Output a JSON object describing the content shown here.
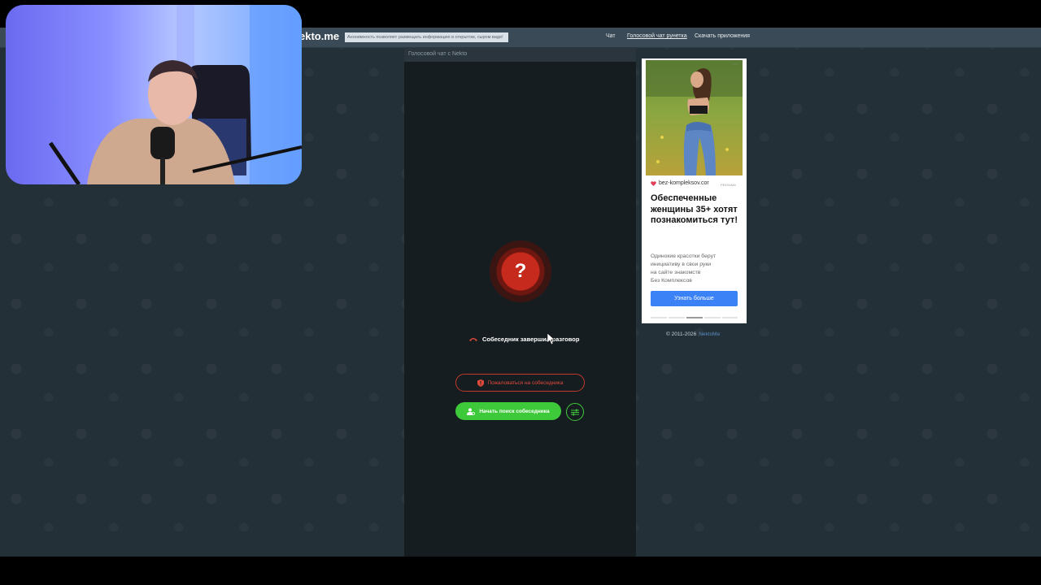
{
  "header": {
    "logo": "ekto.me",
    "banner": "Анонимность позволяет размещать информацию в открытом, сыром виде!",
    "nav": [
      {
        "label": "Чат",
        "active": false
      },
      {
        "label": "Голосовой чат рунетка",
        "active": true
      },
      {
        "label": "Скачать приложения",
        "active": false
      }
    ]
  },
  "chat": {
    "header": "Голосовой чат с Nekto",
    "status_icon": "question-mark-icon",
    "status_text": "Собеседник завершил разговор",
    "report_label": "Пожаловаться на собеседника",
    "search_label": "Начать поиск собеседника"
  },
  "ad": {
    "source": "bez-kompleksov.cor",
    "tag": "РЕКЛАМА",
    "title": "Обеспеченные женщины 35+ хотят познакомиться тут!",
    "text": "Одинокие красотки берут\nинициативу в свои руки\nна сайте знакомств\nБез Комплексов",
    "button": "Узнать больше"
  },
  "footer": {
    "copyright": "© 2011-2026",
    "link": "NektoMe"
  },
  "colors": {
    "accent_green": "#3ec93a",
    "alert_red": "#c62a1c",
    "ad_button": "#3b82f6",
    "topbar": "#3a4a56"
  }
}
